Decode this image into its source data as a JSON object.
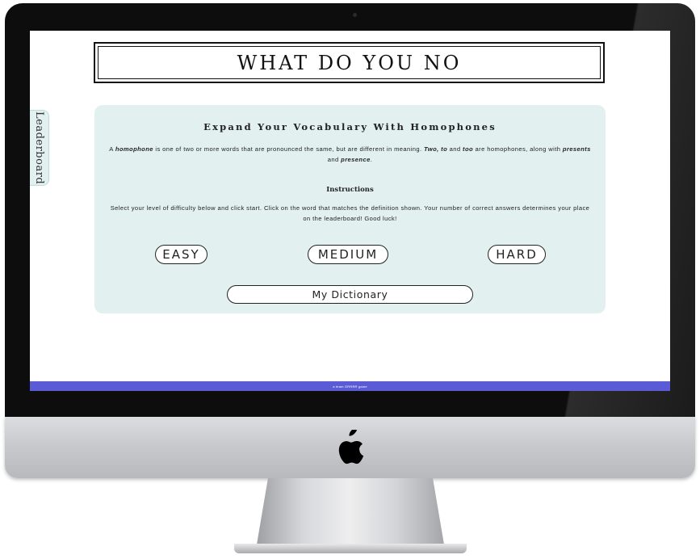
{
  "page": {
    "title": "WHAT DO YOU NO",
    "leaderboard_tab": "Leaderboard"
  },
  "intro": {
    "heading": "Expand Your Vocabulary With Homophones",
    "text_1": "A ",
    "term": "homophone",
    "text_2": " is one of two or more words that are pronounced the same, but are different in meaning. ",
    "example_1": "Two, to",
    "text_3": " and ",
    "example_2": "too",
    "text_4": " are homophones, along with ",
    "example_3": "presents",
    "text_5": " and ",
    "example_4": "presence",
    "text_6": "."
  },
  "instructions": {
    "title": "Instructions",
    "text": "Select your level of difficulty below and click start. Click on the word that matches the definition shown. Your number of correct answers determines your place on the leaderboard! Good luck!"
  },
  "levels": {
    "easy": "EASY",
    "medium": "MEDIUM",
    "hard": "HARD"
  },
  "dictionary_button": "My Dictionary",
  "footer": {
    "text": "a team GRRRR game"
  },
  "colors": {
    "panel": "#e2f1f0",
    "footer": "#5b5bd6",
    "bezel": "#0d0d0d",
    "chin": "#c9cacd"
  },
  "icons": {
    "brand": "apple-logo-icon",
    "camera": "camera-icon"
  }
}
